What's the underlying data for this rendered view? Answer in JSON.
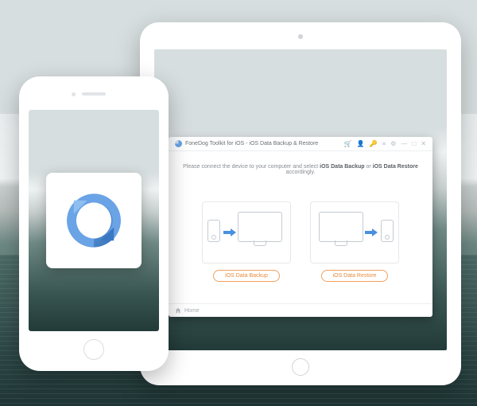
{
  "app": {
    "title": "FoneDog Toolkit for iOS - iOS Data Backup & Restore",
    "instruction_prefix": "Please connect the device to your computer and select ",
    "instruction_bold1": "iOS Data Backup",
    "instruction_mid": " or ",
    "instruction_bold2": "iOS Data Restore",
    "instruction_suffix": " accordingly.",
    "backup_btn": "iOS Data Backup",
    "restore_btn": "iOS Data Restore",
    "footer_home": "Home",
    "titlebar_icons": {
      "cart": "cart-icon",
      "user": "user-icon",
      "key": "key-icon",
      "menu": "menu-icon",
      "settings": "settings-icon",
      "minimize": "minimize-icon",
      "maximize": "maximize-icon",
      "close": "close-icon"
    }
  },
  "colors": {
    "accent_orange": "#e88b3a",
    "accent_blue": "#4a90e2",
    "logo_blue_dark": "#2f6db8",
    "logo_blue_light": "#7fb3ea"
  }
}
